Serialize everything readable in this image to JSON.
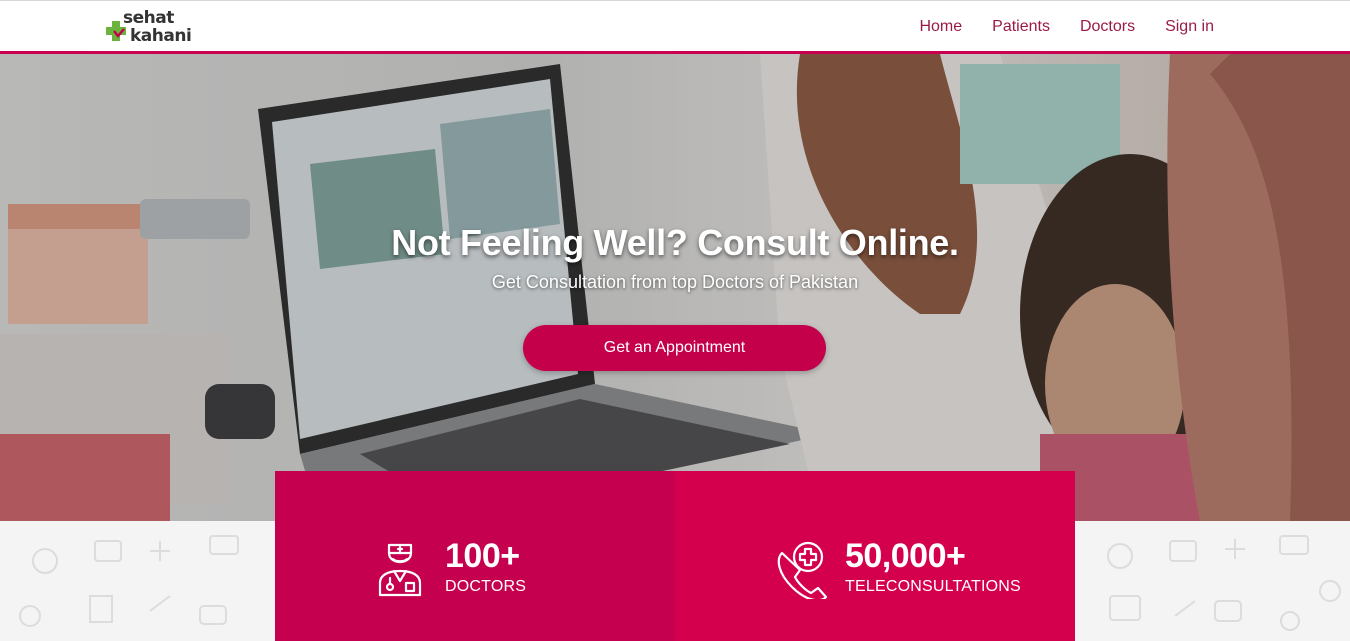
{
  "header": {
    "logo_text_top": "sehat",
    "logo_text_bottom": "kahani",
    "nav": [
      "Home",
      "Patients",
      "Doctors",
      "Sign in"
    ]
  },
  "hero": {
    "title": "Not Feeling Well? Consult Online.",
    "subtitle": "Get Consultation from top Doctors of Pakistan",
    "cta_label": "Get an Appointment"
  },
  "stats": [
    {
      "value": "100+",
      "label": "DOCTORS",
      "icon": "doctor-icon"
    },
    {
      "value": "50,000+",
      "label": "TELECONSULTATIONS",
      "icon": "phone-medical-icon"
    }
  ],
  "colors": {
    "brand": "#c5004b",
    "brand_alt": "#d4004e",
    "nav_text": "#9b1b45",
    "logo_green": "#6ab43e"
  }
}
